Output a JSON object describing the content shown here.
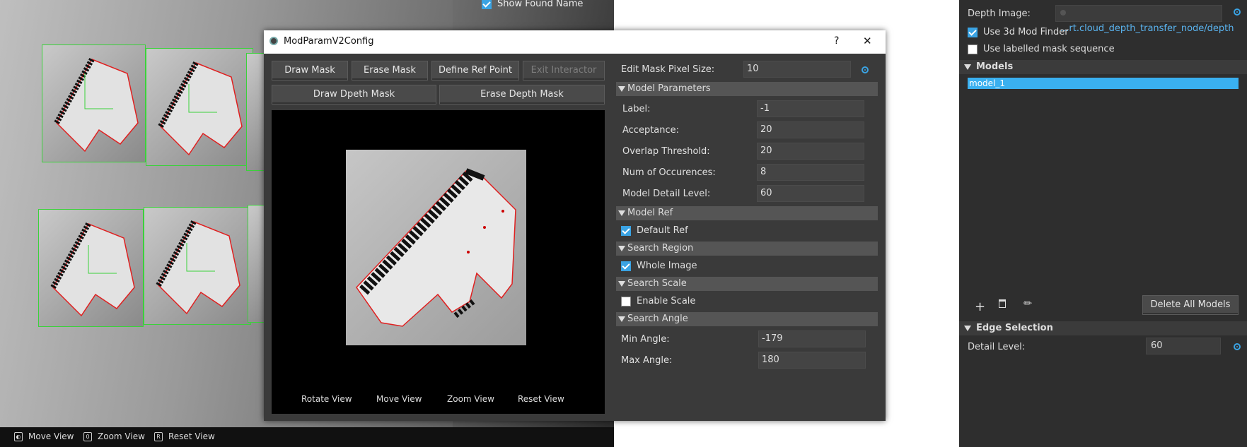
{
  "background": {
    "show_found_name": "Show Found Name",
    "toolbar": {
      "move_view": "Move View",
      "zoom_view": "Zoom View",
      "reset_view": "Reset View",
      "zoom_key": "0",
      "reset_key": "R"
    }
  },
  "side_panel": {
    "depth_image_label": "Depth Image:",
    "depth_image_value": "...rt.cloud_depth_transfer_node/depth",
    "use_3d_mod_finder": "Use 3d Mod Finder",
    "use_labelled_mask": "Use labelled mask sequence",
    "models_header": "Models",
    "models": [
      "model_1"
    ],
    "delete_all_models": "Delete All Models",
    "edge_selection_header": "Edge Selection",
    "detail_level_label": "Detail Level:",
    "detail_level_value": "60"
  },
  "dialog": {
    "title": "ModParamV2Config",
    "help": "?",
    "close": "✕",
    "buttons": {
      "draw_mask": "Draw Mask",
      "erase_mask": "Erase Mask",
      "define_ref_point": "Define Ref Point",
      "exit_interactor": "Exit Interactor",
      "draw_depth_mask": "Draw Dpeth Mask",
      "erase_depth_mask": "Erase Depth Mask"
    },
    "view_controls": {
      "rotate": "Rotate View",
      "move": "Move View",
      "zoom": "Zoom View",
      "reset": "Reset View"
    },
    "edit_mask_pixel_size_label": "Edit Mask Pixel Size:",
    "edit_mask_pixel_size_value": "10",
    "model_parameters": {
      "header": "Model Parameters",
      "label_label": "Label:",
      "label_value": "-1",
      "acceptance_label": "Acceptance:",
      "acceptance_value": "20",
      "overlap_label": "Overlap Threshold:",
      "overlap_value": "20",
      "occurrences_label": "Num of Occurences:",
      "occurrences_value": "8",
      "detail_label": "Model Detail Level:",
      "detail_value": "60"
    },
    "model_ref": {
      "header": "Model Ref",
      "default_ref": "Default Ref"
    },
    "search_region": {
      "header": "Search Region",
      "whole_image": "Whole Image"
    },
    "search_scale": {
      "header": "Search Scale",
      "enable_scale": "Enable Scale"
    },
    "search_angle": {
      "header": "Search Angle",
      "min_label": "Min Angle:",
      "min_value": "-179",
      "max_label": "Max Angle:",
      "max_value": "180"
    }
  },
  "colors": {
    "accent": "#3aa3e3",
    "selection": "#3ab0f0",
    "match_box": "#3bd13b",
    "contour": "#e02020"
  }
}
